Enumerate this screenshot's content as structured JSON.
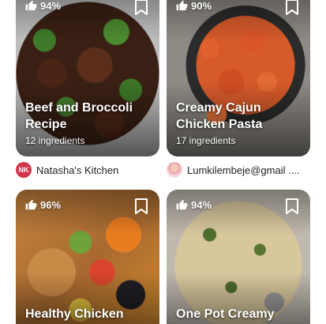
{
  "cards": [
    {
      "rating": "94%",
      "title_line1": "Beef and Broccoli",
      "title_line2": "Recipe",
      "ingredients": "12 ingredients",
      "author": "Natasha's Kitchen",
      "avatar_initials": "NK"
    },
    {
      "rating": "90%",
      "title_line1": "Creamy Cajun",
      "title_line2": "Chicken Pasta",
      "ingredients": "17 ingredients",
      "author": "Lumkilembeje@gmail ...."
    },
    {
      "rating": "96%",
      "title_line1": "Healthy Chicken"
    },
    {
      "rating": "94%",
      "title_line1": "One Pot Creamy"
    }
  ],
  "colors": {
    "avatar_nk": "#d0344a",
    "text_primary": "#222222"
  },
  "icons": [
    "thumbs-up-icon",
    "bookmark-icon"
  ]
}
